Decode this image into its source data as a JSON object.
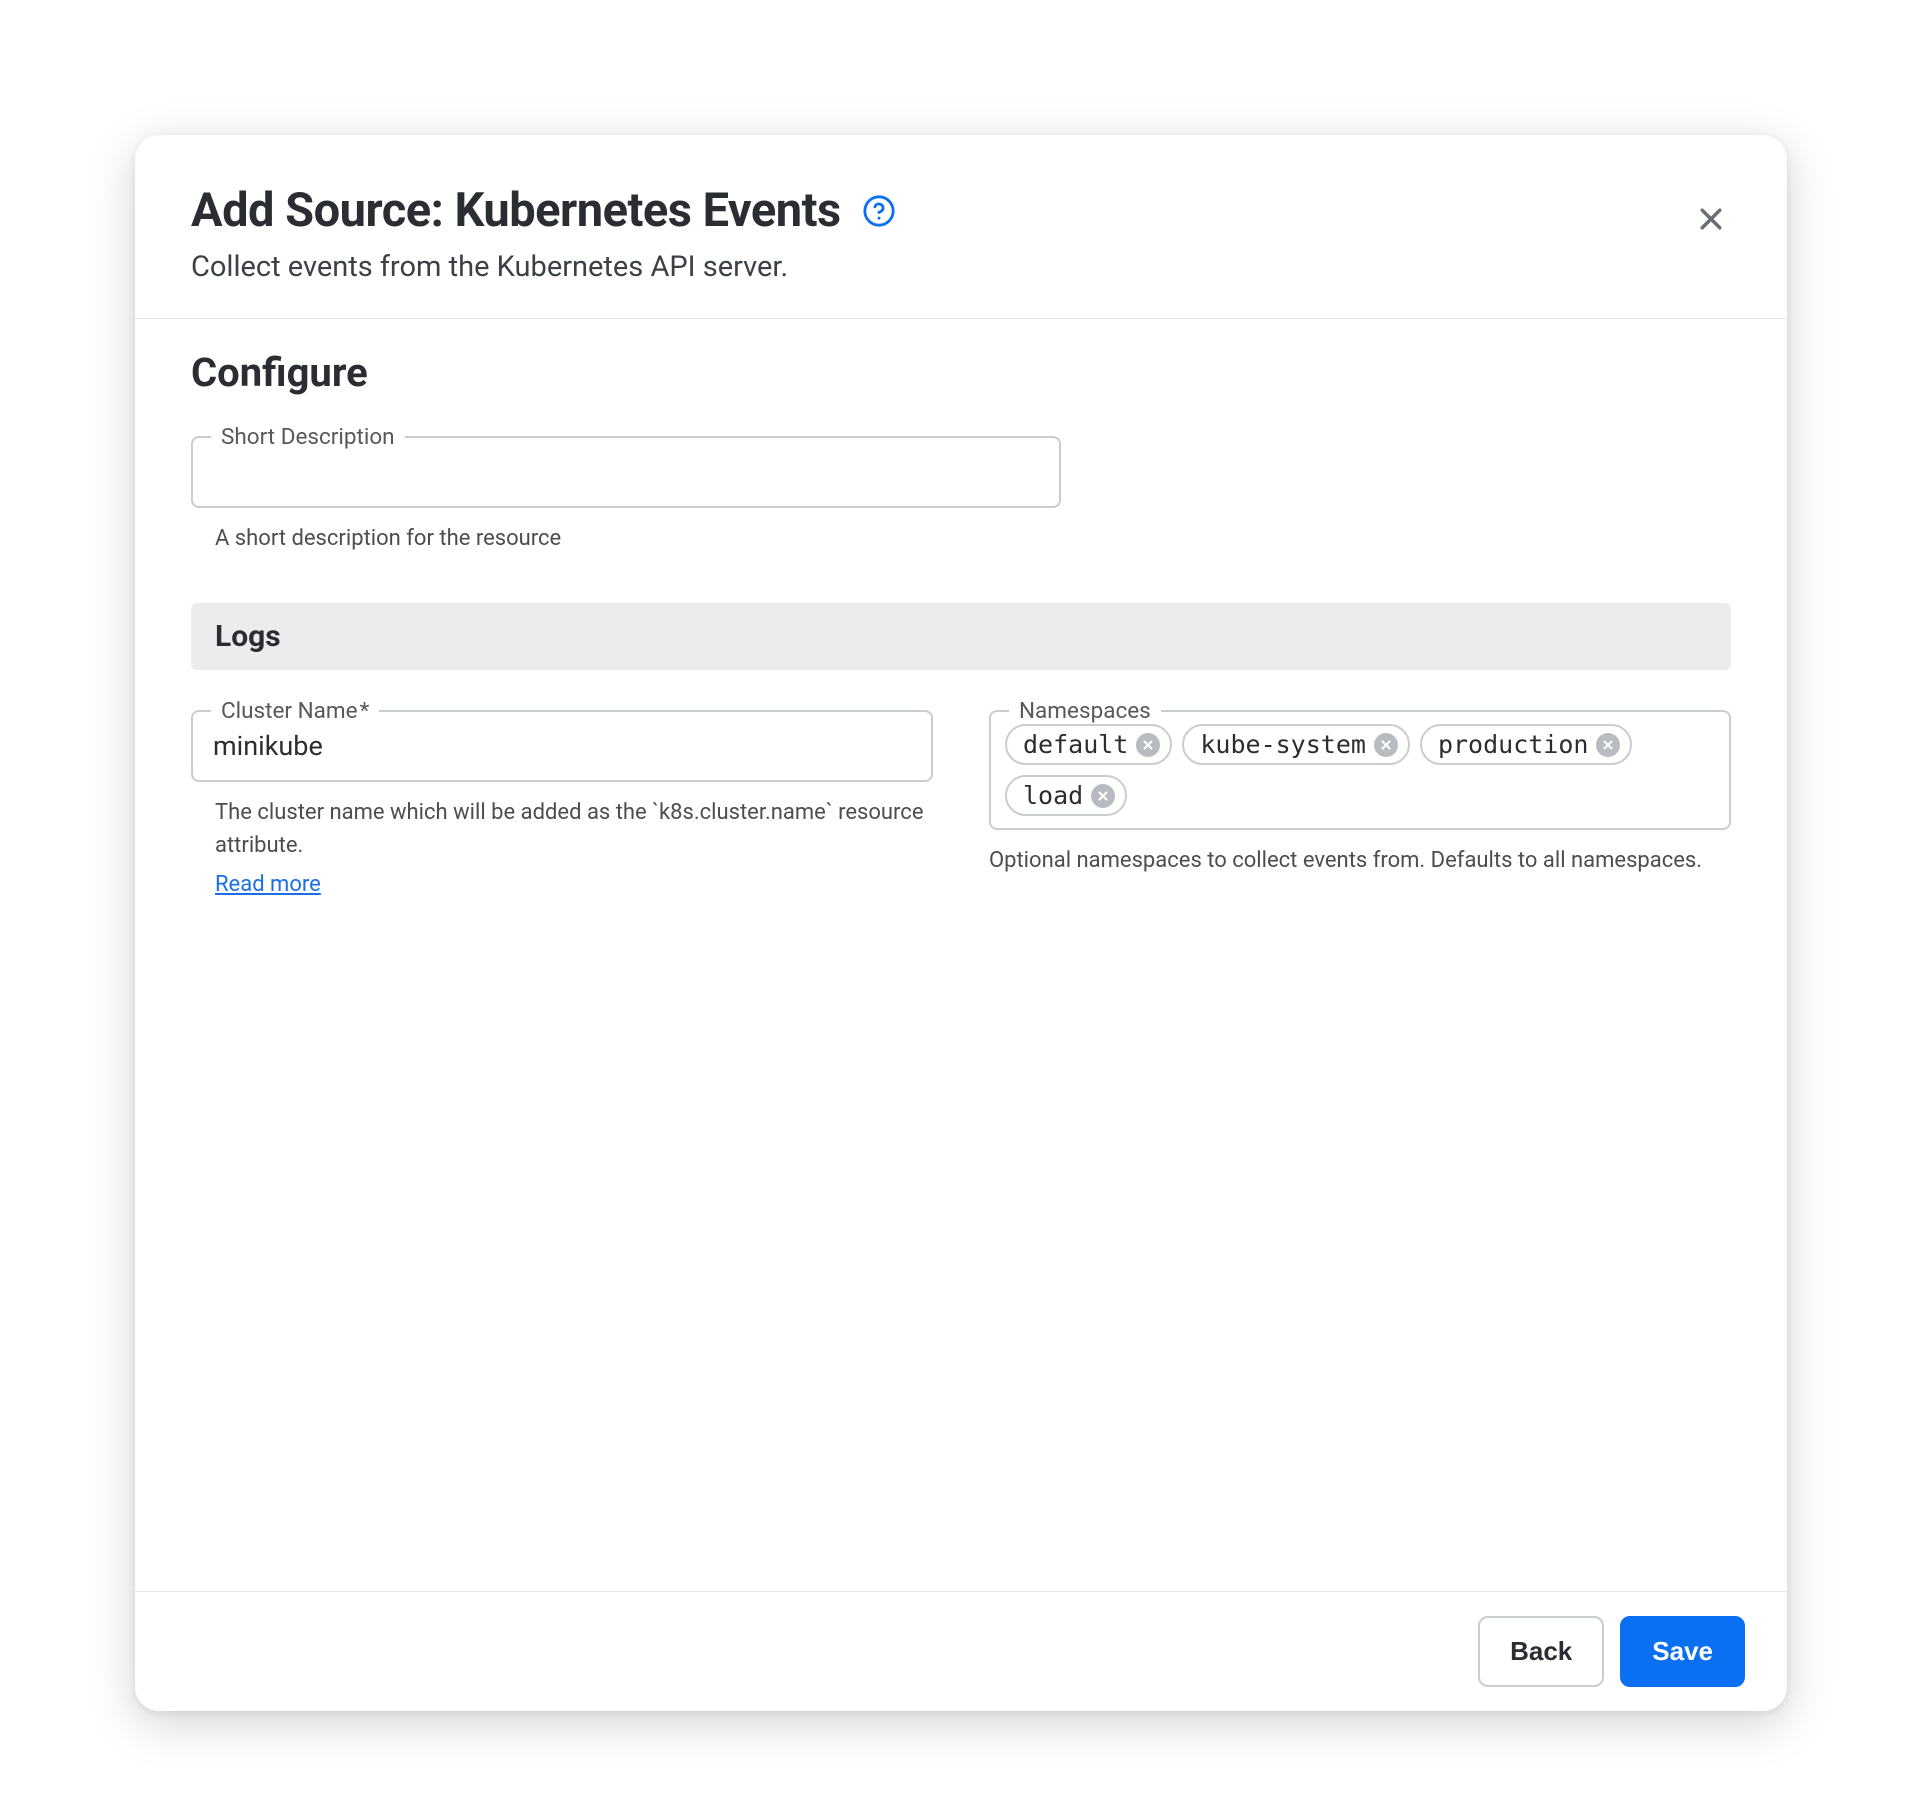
{
  "header": {
    "title": "Add Source: Kubernetes Events",
    "subtitle": "Collect events from the Kubernetes API server."
  },
  "configure": {
    "heading": "Configure",
    "short_description": {
      "label": "Short Description",
      "value": "",
      "help": "A short description for the resource"
    },
    "logs_heading": "Logs",
    "cluster_name": {
      "label": "Cluster Name",
      "required_mark": "*",
      "value": "minikube",
      "help": "The cluster name which will be added as the `k8s.cluster.name` resource attribute.",
      "read_more": "Read more"
    },
    "namespaces": {
      "label": "Namespaces",
      "chips": [
        "default",
        "kube-system",
        "production",
        "load"
      ],
      "help": "Optional namespaces to collect events from. Defaults to all namespaces."
    }
  },
  "footer": {
    "back": "Back",
    "save": "Save"
  }
}
